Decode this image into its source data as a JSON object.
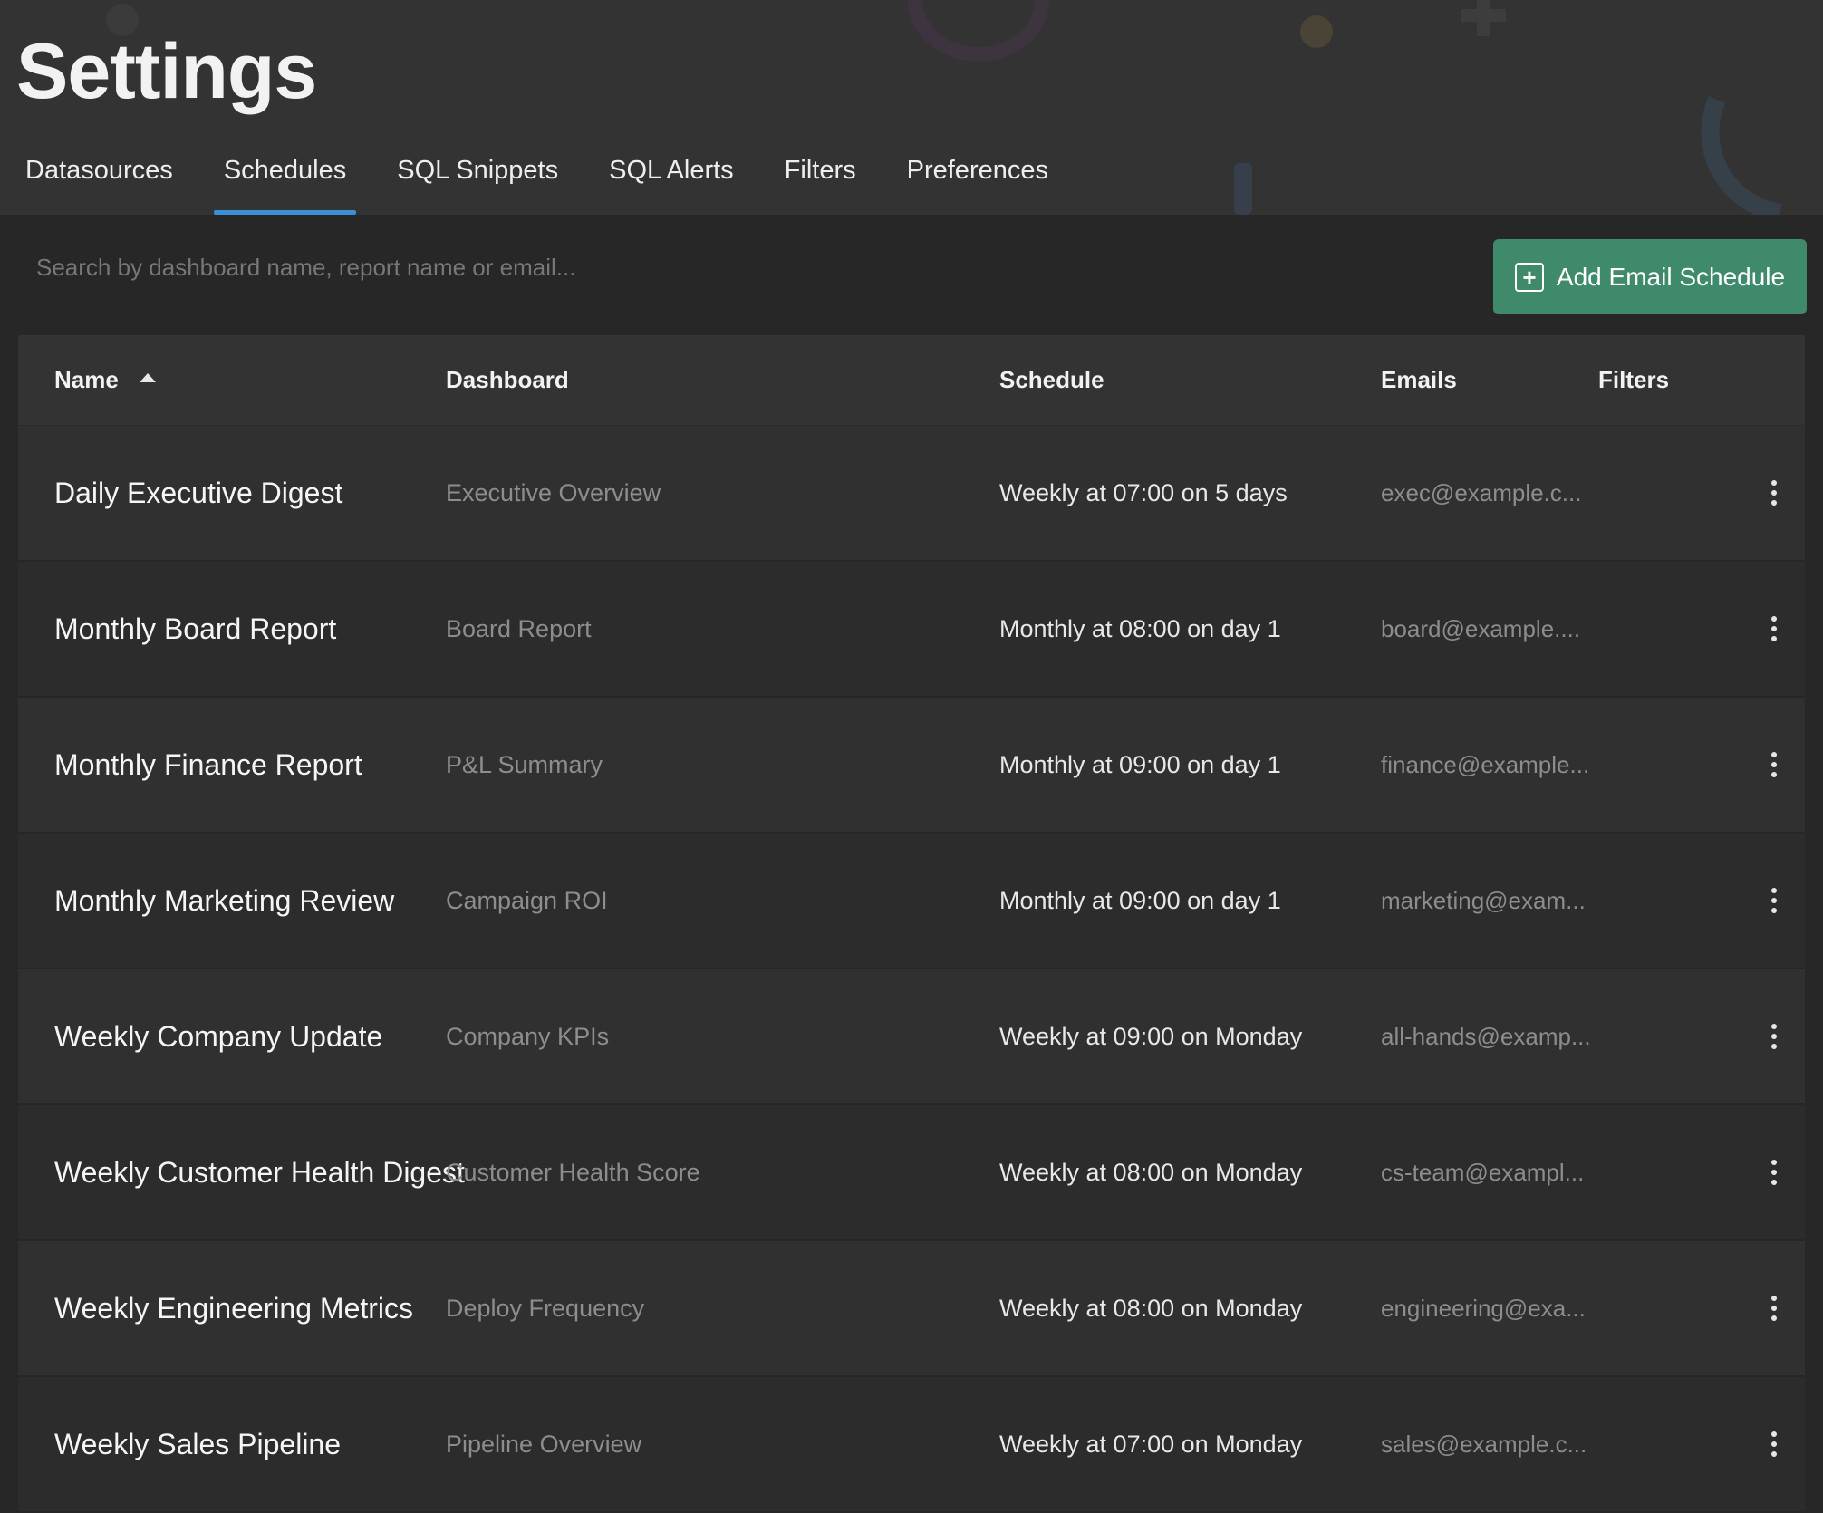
{
  "page": {
    "title": "Settings"
  },
  "tabs": [
    {
      "label": "Datasources",
      "active": false
    },
    {
      "label": "Schedules",
      "active": true
    },
    {
      "label": "SQL Snippets",
      "active": false
    },
    {
      "label": "SQL Alerts",
      "active": false
    },
    {
      "label": "Filters",
      "active": false
    },
    {
      "label": "Preferences",
      "active": false
    }
  ],
  "search": {
    "placeholder": "Search by dashboard name, report name or email...",
    "value": ""
  },
  "add_button": {
    "label": "Add Email Schedule",
    "icon": "plus-square-icon"
  },
  "table": {
    "columns": {
      "name": "Name",
      "dashboard": "Dashboard",
      "schedule": "Schedule",
      "emails": "Emails",
      "filters": "Filters"
    },
    "sort": {
      "column": "name",
      "direction": "asc"
    },
    "rows": [
      {
        "name": "Daily Executive Digest",
        "dashboard": "Executive Overview",
        "schedule": "Weekly at 07:00 on 5 days",
        "emails": "exec@example.c..."
      },
      {
        "name": "Monthly Board Report",
        "dashboard": "Board Report",
        "schedule": "Monthly at 08:00 on day 1",
        "emails": "board@example...."
      },
      {
        "name": "Monthly Finance Report",
        "dashboard": "P&L Summary",
        "schedule": "Monthly at 09:00 on day 1",
        "emails": "finance@example..."
      },
      {
        "name": "Monthly Marketing Review",
        "dashboard": "Campaign ROI",
        "schedule": "Monthly at 09:00 on day 1",
        "emails": "marketing@exam..."
      },
      {
        "name": "Weekly Company Update",
        "dashboard": "Company KPIs",
        "schedule": "Weekly at 09:00 on Monday",
        "emails": "all-hands@examp..."
      },
      {
        "name": "Weekly Customer Health Digest",
        "dashboard": "Customer Health Score",
        "schedule": "Weekly at 08:00 on Monday",
        "emails": "cs-team@exampl..."
      },
      {
        "name": "Weekly Engineering Metrics",
        "dashboard": "Deploy Frequency",
        "schedule": "Weekly at 08:00 on Monday",
        "emails": "engineering@exa..."
      },
      {
        "name": "Weekly Sales Pipeline",
        "dashboard": "Pipeline Overview",
        "schedule": "Weekly at 07:00 on Monday",
        "emails": "sales@example.c..."
      }
    ]
  },
  "colors": {
    "background": "#272727",
    "header": "#333333",
    "accent_tab": "#3a8fd6",
    "primary_button": "#3f8a6b"
  }
}
